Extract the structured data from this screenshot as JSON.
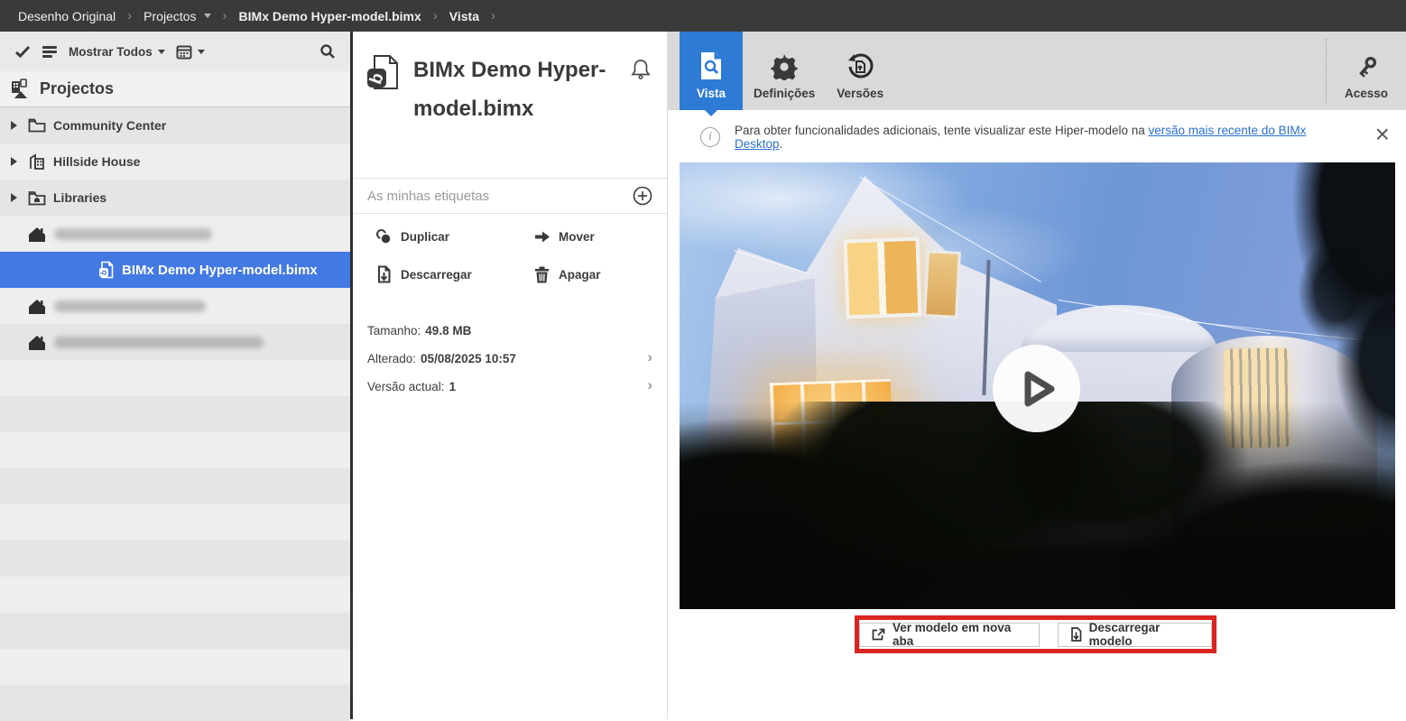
{
  "breadcrumb": {
    "items": [
      {
        "label": "Desenho Original"
      },
      {
        "label": "Projectos"
      },
      {
        "label": "BIMx Demo Hyper-model.bimx"
      },
      {
        "label": "Vista"
      }
    ]
  },
  "sidebar": {
    "toolbar": {
      "filter_label": "Mostrar Todos",
      "icons": [
        "check-icon",
        "list-icon",
        "calendar-icon",
        "search-icon"
      ]
    },
    "header": {
      "title": "Projectos",
      "icon": "projects-buildings-icon"
    },
    "tree": [
      {
        "label": "Community Center",
        "icon": "folder-icon"
      },
      {
        "label": "Hillside House",
        "icon": "building-icon"
      },
      {
        "label": "Libraries",
        "icon": "library-folder-icon"
      }
    ],
    "selected_item": {
      "label": "BIMx Demo Hyper-model.bimx",
      "icon": "bimx-file-icon"
    },
    "redacted_items": 3
  },
  "details": {
    "title": "BIMx Demo Hyper-model.bimx",
    "file_icon": "bimx-file-icon",
    "notification_icon": "bell-icon",
    "tags_placeholder": "As minhas etiquetas",
    "add_tag_icon": "plus-circle-icon",
    "actions": [
      {
        "label": "Duplicar",
        "icon": "duplicate-icon"
      },
      {
        "label": "Mover",
        "icon": "move-arrow-icon"
      },
      {
        "label": "Descarregar",
        "icon": "download-file-icon"
      },
      {
        "label": "Apagar",
        "icon": "trash-icon"
      }
    ],
    "meta": {
      "size_label": "Tamanho:",
      "size_value": "49.8 MB",
      "modified_label": "Alterado:",
      "modified_value": "05/08/2025 10:57",
      "version_label": "Versão actual:",
      "version_value": "1"
    }
  },
  "content": {
    "tabs": [
      {
        "label": "Vista",
        "icon": "document-preview-icon",
        "active": true
      },
      {
        "label": "Definições",
        "icon": "gear-icon",
        "active": false
      },
      {
        "label": "Versões",
        "icon": "version-history-icon",
        "active": false
      }
    ],
    "access": {
      "label": "Acesso",
      "icon": "key-icon"
    },
    "banner": {
      "info_icon": "info-circle-icon",
      "text_before": "Para obter funcionalidades adicionais, tente visualizar este Hiper-modelo na ",
      "link_text": "versão mais recente do BIMx Desktop",
      "text_after": ".",
      "close_icon": "close-icon"
    },
    "viewer": {
      "play_icon": "play-icon"
    },
    "viewer_buttons": [
      {
        "label": "Ver modelo em nova aba",
        "icon": "open-new-tab-icon"
      },
      {
        "label": "Descarregar modelo",
        "icon": "download-icon"
      }
    ]
  },
  "colors": {
    "accent_blue": "#2e7bd6",
    "selection_blue": "#4379e2",
    "link_blue": "#2a6fd4",
    "annotation_red": "#da2420",
    "breadcrumb_bg": "#3a3a3a"
  }
}
